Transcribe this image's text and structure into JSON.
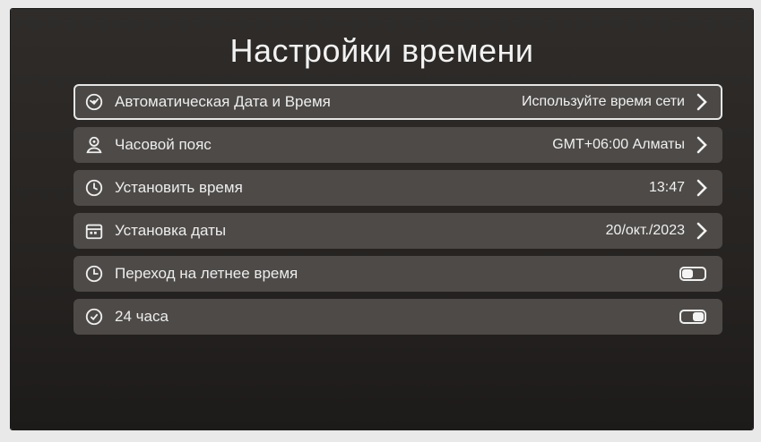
{
  "screen": {
    "title": "Настройки времени"
  },
  "settings": [
    {
      "label": "Автоматическая Дата и Время",
      "value": "Используйте время сети",
      "icon": "auto-datetime-icon"
    },
    {
      "label": "Часовой пояс",
      "value": "GMT+06:00 Алматы",
      "icon": "timezone-icon"
    },
    {
      "label": "Установить время",
      "value": "13:47",
      "icon": "clock-icon"
    },
    {
      "label": "Установка даты",
      "value": "20/окт./2023",
      "icon": "calendar-icon"
    },
    {
      "label": "Переход на летнее время",
      "toggle": "off",
      "icon": "daylight-saving-icon"
    },
    {
      "label": "24 часа",
      "toggle": "on",
      "icon": "clock-24h-icon"
    }
  ],
  "colors": {
    "panel_bg": "#2a2726",
    "row_bg": "#4d4a48",
    "text": "#ededed",
    "focus_border": "#e6e6e6"
  }
}
